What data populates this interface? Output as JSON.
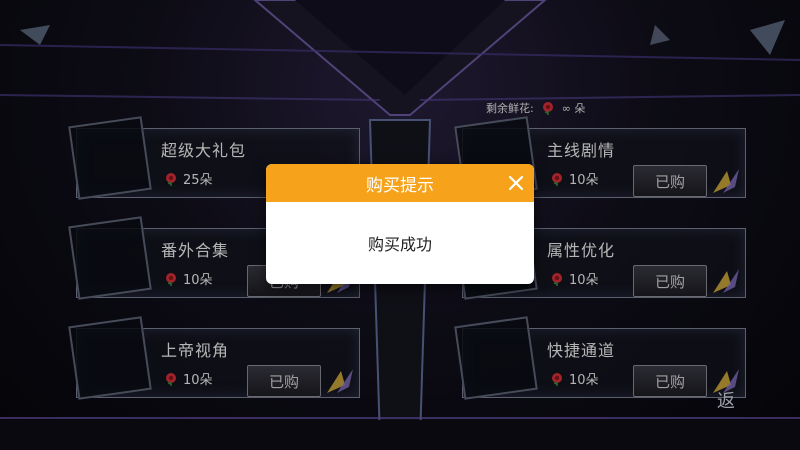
{
  "header": {
    "remaining_label": "剩余鲜花:",
    "remaining_value": "∞ 朵"
  },
  "items": [
    {
      "name": "超级大礼包",
      "price": "25朵"
    },
    {
      "name": "主线剧情",
      "price": "10朵",
      "status": "已购"
    },
    {
      "name": "番外合集",
      "price": "10朵",
      "status": "已购"
    },
    {
      "name": "属性优化",
      "price": "10朵",
      "status": "已购"
    },
    {
      "name": "上帝视角",
      "price": "10朵",
      "status": "已购"
    },
    {
      "name": "快捷通道",
      "price": "10朵",
      "status": "已购"
    }
  ],
  "back_label": "返",
  "dialog": {
    "title": "购买提示",
    "message": "购买成功"
  },
  "colors": {
    "dialog_header": "#f6a31b",
    "background": "#07070d",
    "rose": "#d8313a"
  },
  "icons": {
    "flower": "rose-icon",
    "close": "close-icon"
  }
}
